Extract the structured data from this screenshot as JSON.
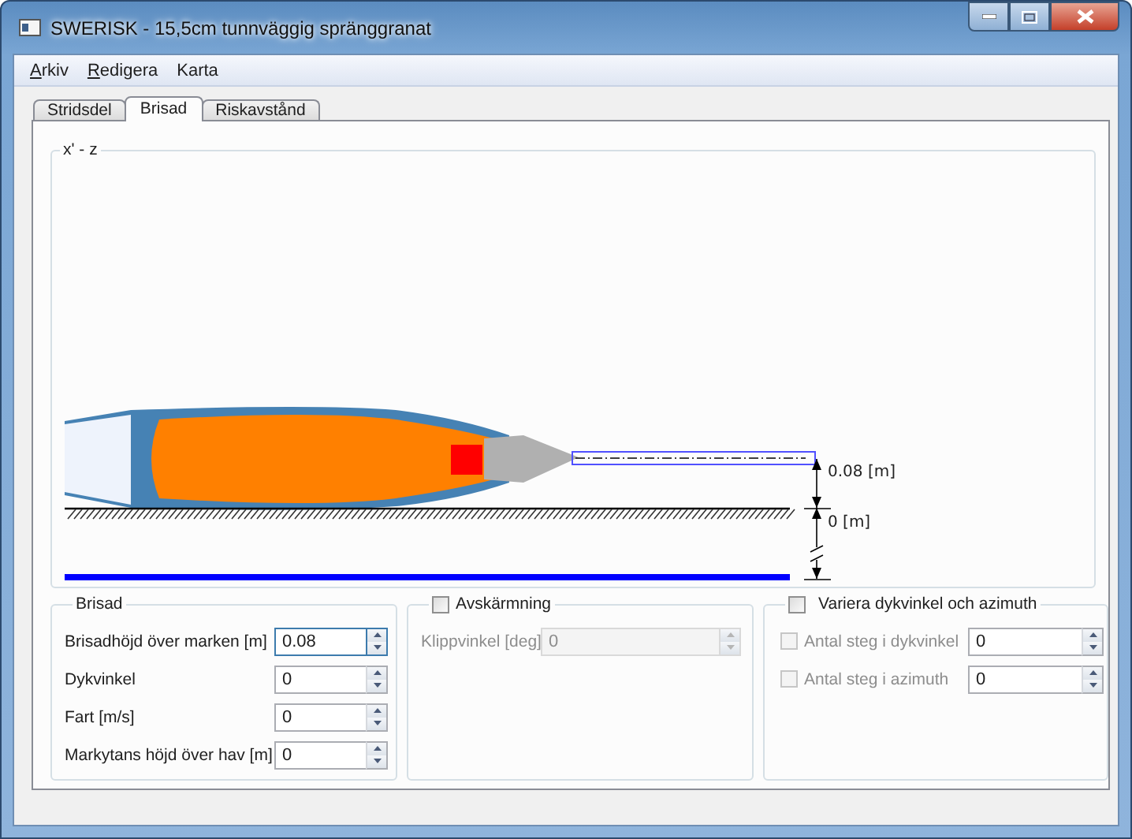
{
  "window": {
    "title": "SWERISK - 15,5cm tunnväggig spränggranat"
  },
  "menu": [
    {
      "label": "Arkiv",
      "underline_first": true
    },
    {
      "label": "Redigera",
      "underline_first": true
    },
    {
      "label": "Karta",
      "underline_first": false
    }
  ],
  "tabs": [
    {
      "label": "Stridsdel",
      "selected": false
    },
    {
      "label": "Brisad",
      "selected": true
    },
    {
      "label": "Riskavstånd",
      "selected": false
    }
  ],
  "plot": {
    "title": "x' - z",
    "burst_height_label": "0.08 [m]",
    "ground_level_label": "0 [m]"
  },
  "brisad": {
    "title": "Brisad",
    "fields": [
      {
        "label": "Brisadhöjd över marken [m]",
        "value": "0.08",
        "focused": true
      },
      {
        "label": "Dykvinkel",
        "value": "0",
        "focused": false
      },
      {
        "label": "Fart [m/s]",
        "value": "0",
        "focused": false
      },
      {
        "label": "Markytans höjd över hav [m]",
        "value": "0",
        "focused": false
      }
    ]
  },
  "avskarmning": {
    "label": "Avskärmning",
    "checked": false,
    "fields": [
      {
        "label": "Klippvinkel [deg]",
        "value": "0",
        "disabled": true
      }
    ]
  },
  "variera": {
    "label": "Variera dykvinkel och azimuth",
    "checked": false,
    "rows": [
      {
        "label": "Antal steg i dykvinkel",
        "checked": false,
        "disabled": true,
        "value": "0"
      },
      {
        "label": "Antal steg i azimuth",
        "checked": false,
        "disabled": true,
        "value": "0"
      }
    ]
  }
}
